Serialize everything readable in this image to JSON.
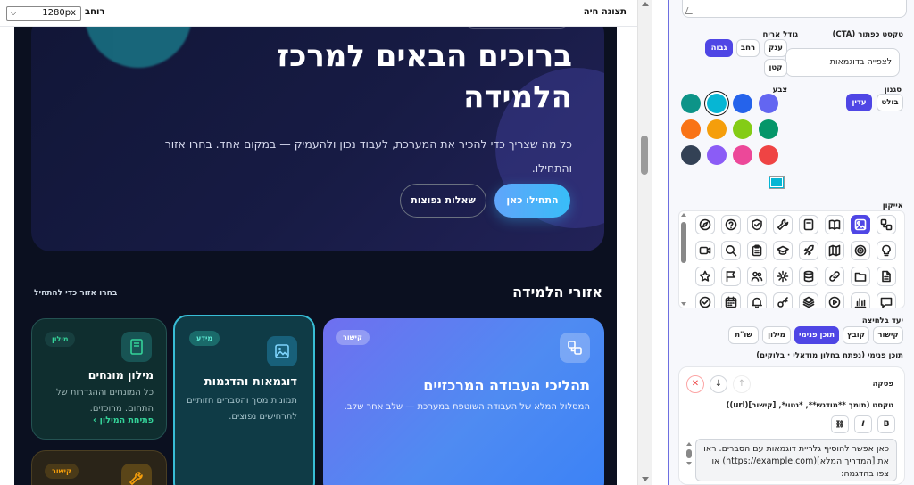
{
  "preview": {
    "title": "תצוגה חיה",
    "width_label": "רוחב",
    "width_value": "1280px"
  },
  "hero": {
    "title": "ברוכים הבאים למרכז הלמידה",
    "description": "כל מה שצריך כדי להכיר את המערכת, לעבוד נכון ולהעמיק — במקום אחד. בחרו אזור והתחילו.",
    "primary_button": "התחילו כאן",
    "secondary_button": "שאלות נפוצות"
  },
  "areas": {
    "title": "אזורי הלמידה",
    "subtitle": "בחרו אזור כדי להתחיל",
    "cards": [
      {
        "badge": "קישור",
        "title": "תהליכי העבודה המרכזיים",
        "description": "המסלול המלא של העבודה השוטפת במערכת — שלב אחר שלב.",
        "icon": "workflow-icon"
      },
      {
        "badge": "מידע",
        "title": "דוגמאות והדגמות",
        "description": "תמונות מסך והסברים חזותיים לתרחישים נפוצים.",
        "icon": "image-icon"
      },
      {
        "badge": "מילון",
        "title": "מילון מונחים",
        "description": "כל המונחים וההגדרות של התחום. מרוכזים.",
        "link": "פתיחת המילון",
        "icon": "book-icon"
      },
      {
        "badge": "קישור",
        "icon": "wrench-icon"
      }
    ]
  },
  "editor": {
    "cta_label": "טקסט כפתור (CTA)",
    "cta_value": "לצפייה בדוגמאות",
    "size_label": "גודל אריח",
    "sizes": [
      "גבוה",
      "רחב",
      "ענק",
      "קטן"
    ],
    "size_selected": "גבוה",
    "style_label": "סגנון",
    "styles": [
      "עדין",
      "בולט"
    ],
    "style_selected": "עדין",
    "color_label": "צבע",
    "colors": [
      "#6366f1",
      "#2563eb",
      "#06b6d4",
      "#0d9488",
      "#059669",
      "#84cc16",
      "#f59e0b",
      "#f97316",
      "#ef4444",
      "#ec4899",
      "#8b5cf6",
      "#334155"
    ],
    "color_selected": "#06b6d4",
    "icon_label": "אייקון",
    "icons": [
      "workflow-icon",
      "image-icon",
      "book-open-icon",
      "bookmark-icon",
      "wrench-icon",
      "shield-check-icon",
      "help-circle-icon",
      "compass-icon",
      "lightbulb-icon",
      "target-icon",
      "map-icon",
      "rocket-icon",
      "graduation-cap-icon",
      "clipboard-icon",
      "search-icon",
      "video-icon",
      "file-text-icon",
      "folder-icon",
      "link-icon",
      "database-icon",
      "settings-icon",
      "users-icon",
      "flag-icon",
      "star-icon",
      "message-icon",
      "bar-chart-icon",
      "play-circle-icon",
      "layers-icon",
      "key-icon",
      "bell-icon",
      "calendar-icon",
      "check-circle-icon"
    ],
    "icon_selected": "image-icon",
    "target_label": "יעד בלחיצה",
    "targets": [
      "קישור",
      "קובץ",
      "תוכן פנימי",
      "מילון",
      "שו\"ת"
    ],
    "target_selected": "תוכן פנימי",
    "internal_label": "תוכן פנימי (נפתח בחלון מודאלי · בלוקים)",
    "paragraph_label": "פסקה",
    "paragraph_hint": "טקסט (תומך **מודגש**, *נטוי*, [קישור](url))",
    "format_buttons": [
      "B",
      "I",
      "🔗"
    ],
    "paragraph_text": "כאן אפשר להוסיף גלריית דוגמאות עם הסברים. ראו את [המדריך המלא](https://example.com) או צפו בהדגמה:"
  }
}
